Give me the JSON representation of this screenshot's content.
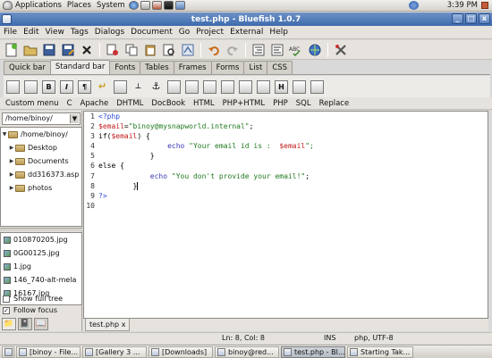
{
  "top_panel": {
    "menus": [
      "Applications",
      "Places",
      "System"
    ],
    "clock": "3:39 PM"
  },
  "window": {
    "title": "test.php - Bluefish 1.0.7"
  },
  "menubar": [
    "File",
    "Edit",
    "View",
    "Tags",
    "Dialogs",
    "Document",
    "Go",
    "Project",
    "External",
    "Help"
  ],
  "main_toolbar": {
    "groups": [
      [
        "new-document-icon",
        "open-file-icon",
        "save-icon",
        "save-as-icon",
        "close-icon"
      ],
      [
        "cut-icon",
        "copy-icon",
        "paste-icon",
        "find-icon",
        "replace-icon"
      ],
      [
        "undo-icon",
        "redo-icon"
      ],
      [
        "indent-icon",
        "unindent-icon",
        "spellcheck-icon",
        "preview-icon"
      ],
      [
        "preferences-icon"
      ]
    ]
  },
  "quickbar_tabs": [
    "Quick bar",
    "Standard bar",
    "Fonts",
    "Tables",
    "Frames",
    "Forms",
    "List",
    "CSS"
  ],
  "active_quickbar_tab": "Standard bar",
  "html_toolbar": {
    "icons": [
      "quickstart-icon",
      "body-icon",
      "bold-icon",
      "italic-icon",
      "paragraph-icon",
      "break-icon",
      "break-clear-icon",
      "nbsp-icon",
      "anchor-icon",
      "rule-icon",
      "center-icon",
      "right-icon",
      "comment-icon",
      "email-icon",
      "font-icon",
      "heading-icon",
      "image-icon",
      "thumbnail-icon"
    ],
    "text_icons": {
      "bold": "B",
      "italic": "I",
      "heading": "H"
    }
  },
  "custom_menu": [
    "Custom menu",
    "C",
    "Apache",
    "DHTML",
    "DocBook",
    "HTML",
    "PHP+HTML",
    "PHP",
    "SQL",
    "Replace"
  ],
  "file_browser": {
    "directory": "/home/binoy/",
    "tree": [
      {
        "label": "/home/binoy/",
        "depth": 0,
        "expanded": true
      },
      {
        "label": "Desktop",
        "depth": 1,
        "expanded": false
      },
      {
        "label": "Documents",
        "depth": 1,
        "expanded": false
      },
      {
        "label": "dd316373.asp",
        "depth": 1,
        "expanded": false
      },
      {
        "label": "photos",
        "depth": 1,
        "expanded": false
      }
    ],
    "files": [
      "010870205.jpg",
      "0G00125.jpg",
      "1.jpg",
      "146_740-alt-mela",
      "16167.jpg"
    ],
    "show_full_tree": {
      "label": "Show full tree",
      "checked": false
    },
    "follow_focus": {
      "label": "Follow focus",
      "checked": true
    }
  },
  "editor": {
    "line_numbers": [
      "1",
      "2",
      "3",
      "4",
      "5",
      "6",
      "7",
      "8",
      "9",
      "10"
    ],
    "lines": [
      [
        {
          "t": "<?php",
          "c": "tag"
        }
      ],
      [
        {
          "t": "$email",
          "c": "var"
        },
        {
          "t": "=",
          "c": "kw"
        },
        {
          "t": "\"binoy@mysnapworld.internal\"",
          "c": "str"
        },
        {
          "t": ";",
          "c": "kw"
        }
      ],
      [
        {
          "t": "if(",
          "c": "kw"
        },
        {
          "t": "$email",
          "c": "var"
        },
        {
          "t": ") {",
          "c": "kw"
        }
      ],
      [
        {
          "t": "                echo ",
          "c": "fn"
        },
        {
          "t": "\"Your email id is :  ",
          "c": "str"
        },
        {
          "t": "$email",
          "c": "var"
        },
        {
          "t": "\";",
          "c": "str"
        }
      ],
      [
        {
          "t": "            }",
          "c": "kw"
        }
      ],
      [
        {
          "t": "else {",
          "c": "kw"
        }
      ],
      [
        {
          "t": "            echo ",
          "c": "fn"
        },
        {
          "t": "\"You don't provide your email!\"",
          "c": "str"
        },
        {
          "t": ";",
          "c": "kw"
        }
      ],
      [
        {
          "t": "        }",
          "c": "kw"
        }
      ],
      [
        {
          "t": "?>",
          "c": "tag"
        }
      ],
      []
    ]
  },
  "document_tab": {
    "label": "test.php",
    "close": "x"
  },
  "statusbar": {
    "position": "Ln: 8, Col: 8",
    "mode": "INS",
    "encoding": "php, UTF-8"
  },
  "taskbar": [
    {
      "label": "[binoy - File...",
      "active": false
    },
    {
      "label": "[Gallery 3 ...",
      "active": false
    },
    {
      "label": "[Downloads]",
      "active": false
    },
    {
      "label": "binoy@red...",
      "active": false
    },
    {
      "label": "test.php - Bl...",
      "active": true
    },
    {
      "label": "Starting Tak...",
      "active": false
    }
  ]
}
